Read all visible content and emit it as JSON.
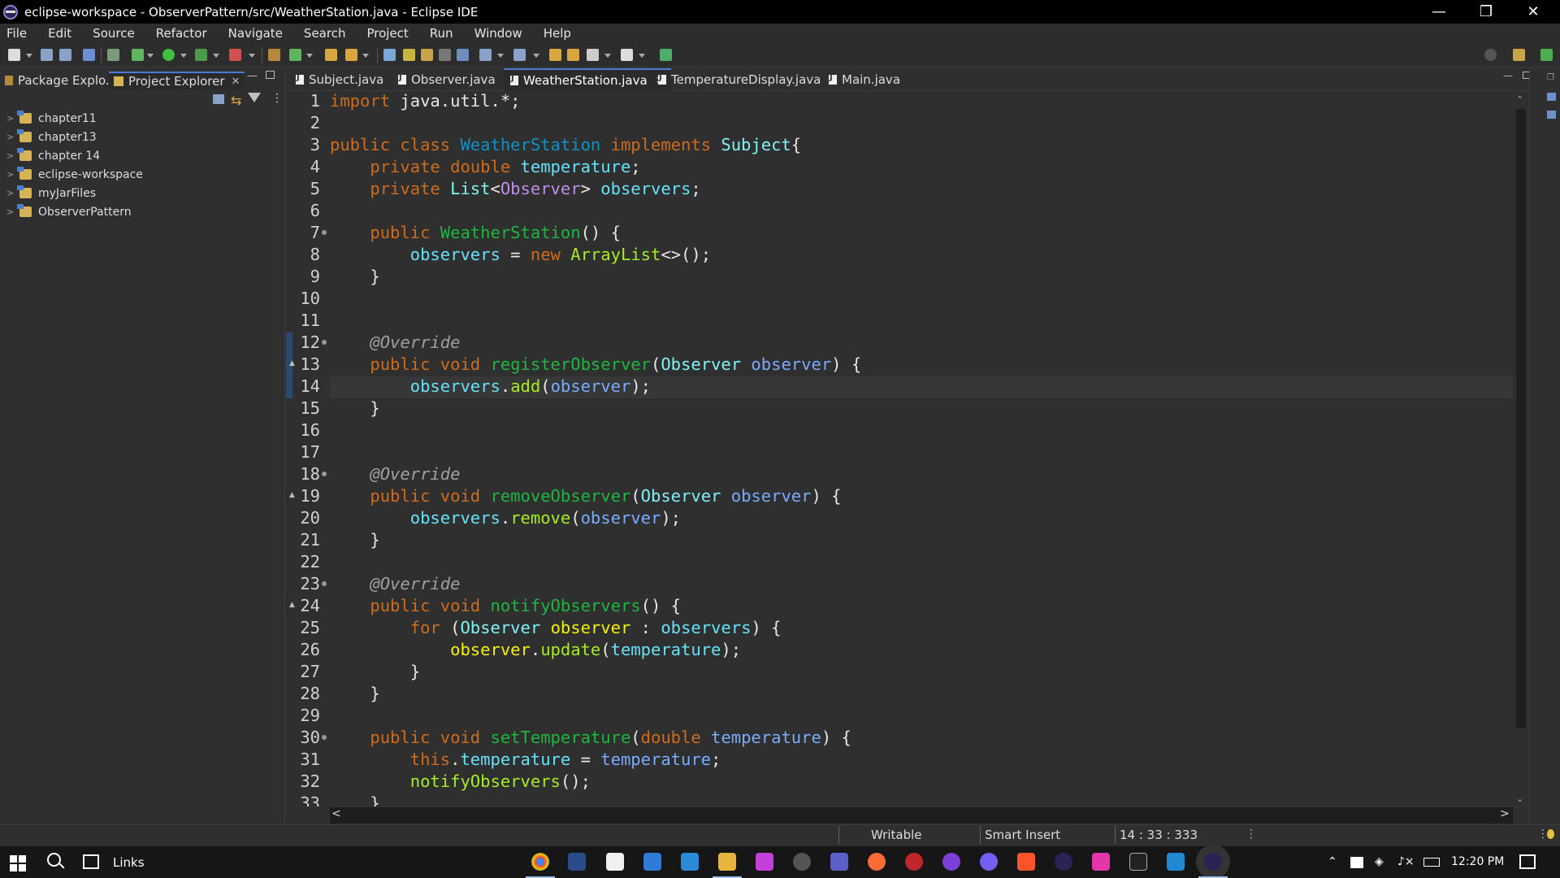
{
  "window": {
    "title": "eclipse-workspace - ObserverPattern/src/WeatherStation.java - Eclipse IDE"
  },
  "menu": [
    "File",
    "Edit",
    "Source",
    "Refactor",
    "Navigate",
    "Search",
    "Project",
    "Run",
    "Window",
    "Help"
  ],
  "explorer": {
    "tabs": [
      "Package Explo...",
      "Project Explorer"
    ],
    "projects": [
      "chapter11",
      "chapter13",
      "chapter 14",
      "eclipse-workspace",
      "myJarFiles",
      "ObserverPattern"
    ]
  },
  "editor": {
    "tabs": [
      "Subject.java",
      "Observer.java",
      "WeatherStation.java",
      "TemperatureDisplay.java",
      "Main.java"
    ],
    "active_tab": "WeatherStation.java",
    "line_numbers": [
      "1",
      "2",
      "3",
      "4",
      "5",
      "6",
      "7",
      "8",
      "9",
      "10",
      "11",
      "12",
      "13",
      "14",
      "15",
      "16",
      "17",
      "18",
      "19",
      "20",
      "21",
      "22",
      "23",
      "24",
      "25",
      "26",
      "27",
      "28",
      "29",
      "30",
      "31",
      "32",
      "33"
    ],
    "lines": [
      "import java.util.*;",
      "",
      "public class WeatherStation implements Subject{",
      "    private double temperature;",
      "    private List<Observer> observers;",
      "",
      "    public WeatherStation() {",
      "        observers = new ArrayList<>();",
      "    }",
      "",
      "",
      "    @Override",
      "    public void registerObserver(Observer observer) {",
      "        observers.add(observer);",
      "    }",
      "",
      "",
      "    @Override",
      "    public void removeObserver(Observer observer) {",
      "        observers.remove(observer);",
      "    }",
      "",
      "    @Override",
      "    public void notifyObservers() {",
      "        for (Observer observer : observers) {",
      "            observer.update(temperature);",
      "        }",
      "    }",
      "",
      "    public void setTemperature(double temperature) {",
      "        this.temperature = temperature;",
      "        notifyObservers();",
      "    }"
    ]
  },
  "status": {
    "writable": "Writable",
    "insert_mode": "Smart Insert",
    "position": "14 : 33 : 333"
  },
  "taskbar": {
    "links_label": "Links",
    "time": "12:20 PM"
  }
}
